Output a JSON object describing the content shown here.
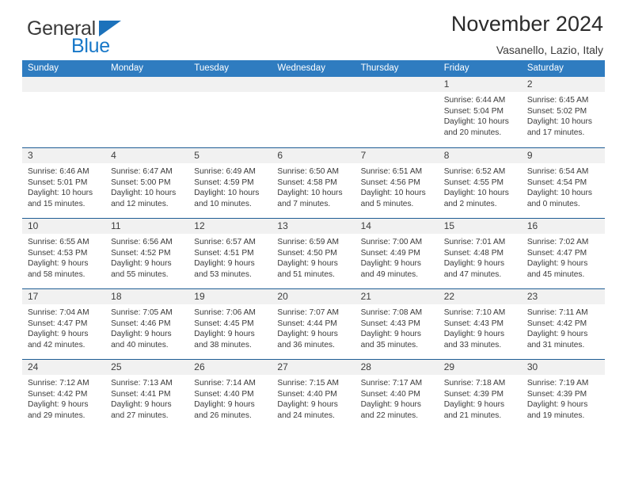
{
  "logo": {
    "word_top": "General",
    "word_bottom": "Blue",
    "triangle_icon": "triangle-icon",
    "color_dark": "#3a3a3a",
    "color_blue": "#1878c8"
  },
  "header": {
    "title": "November 2024",
    "subtitle": "Vasanello, Lazio, Italy"
  },
  "theme": {
    "header_blue": "#2f7cc0",
    "row_rule": "#1f5d94",
    "daynum_bg": "#f1f1f1",
    "text": "#3a3a3a"
  },
  "calendar": {
    "weekdays": [
      "Sunday",
      "Monday",
      "Tuesday",
      "Wednesday",
      "Thursday",
      "Friday",
      "Saturday"
    ],
    "labels": {
      "sunrise": "Sunrise:",
      "sunset": "Sunset:",
      "daylight": "Daylight:"
    },
    "weeks": [
      [
        {
          "day": ""
        },
        {
          "day": ""
        },
        {
          "day": ""
        },
        {
          "day": ""
        },
        {
          "day": ""
        },
        {
          "day": "1",
          "sunrise": "Sunrise: 6:44 AM",
          "sunset": "Sunset: 5:04 PM",
          "daylight": "Daylight: 10 hours and 20 minutes."
        },
        {
          "day": "2",
          "sunrise": "Sunrise: 6:45 AM",
          "sunset": "Sunset: 5:02 PM",
          "daylight": "Daylight: 10 hours and 17 minutes."
        }
      ],
      [
        {
          "day": "3",
          "sunrise": "Sunrise: 6:46 AM",
          "sunset": "Sunset: 5:01 PM",
          "daylight": "Daylight: 10 hours and 15 minutes."
        },
        {
          "day": "4",
          "sunrise": "Sunrise: 6:47 AM",
          "sunset": "Sunset: 5:00 PM",
          "daylight": "Daylight: 10 hours and 12 minutes."
        },
        {
          "day": "5",
          "sunrise": "Sunrise: 6:49 AM",
          "sunset": "Sunset: 4:59 PM",
          "daylight": "Daylight: 10 hours and 10 minutes."
        },
        {
          "day": "6",
          "sunrise": "Sunrise: 6:50 AM",
          "sunset": "Sunset: 4:58 PM",
          "daylight": "Daylight: 10 hours and 7 minutes."
        },
        {
          "day": "7",
          "sunrise": "Sunrise: 6:51 AM",
          "sunset": "Sunset: 4:56 PM",
          "daylight": "Daylight: 10 hours and 5 minutes."
        },
        {
          "day": "8",
          "sunrise": "Sunrise: 6:52 AM",
          "sunset": "Sunset: 4:55 PM",
          "daylight": "Daylight: 10 hours and 2 minutes."
        },
        {
          "day": "9",
          "sunrise": "Sunrise: 6:54 AM",
          "sunset": "Sunset: 4:54 PM",
          "daylight": "Daylight: 10 hours and 0 minutes."
        }
      ],
      [
        {
          "day": "10",
          "sunrise": "Sunrise: 6:55 AM",
          "sunset": "Sunset: 4:53 PM",
          "daylight": "Daylight: 9 hours and 58 minutes."
        },
        {
          "day": "11",
          "sunrise": "Sunrise: 6:56 AM",
          "sunset": "Sunset: 4:52 PM",
          "daylight": "Daylight: 9 hours and 55 minutes."
        },
        {
          "day": "12",
          "sunrise": "Sunrise: 6:57 AM",
          "sunset": "Sunset: 4:51 PM",
          "daylight": "Daylight: 9 hours and 53 minutes."
        },
        {
          "day": "13",
          "sunrise": "Sunrise: 6:59 AM",
          "sunset": "Sunset: 4:50 PM",
          "daylight": "Daylight: 9 hours and 51 minutes."
        },
        {
          "day": "14",
          "sunrise": "Sunrise: 7:00 AM",
          "sunset": "Sunset: 4:49 PM",
          "daylight": "Daylight: 9 hours and 49 minutes."
        },
        {
          "day": "15",
          "sunrise": "Sunrise: 7:01 AM",
          "sunset": "Sunset: 4:48 PM",
          "daylight": "Daylight: 9 hours and 47 minutes."
        },
        {
          "day": "16",
          "sunrise": "Sunrise: 7:02 AM",
          "sunset": "Sunset: 4:47 PM",
          "daylight": "Daylight: 9 hours and 45 minutes."
        }
      ],
      [
        {
          "day": "17",
          "sunrise": "Sunrise: 7:04 AM",
          "sunset": "Sunset: 4:47 PM",
          "daylight": "Daylight: 9 hours and 42 minutes."
        },
        {
          "day": "18",
          "sunrise": "Sunrise: 7:05 AM",
          "sunset": "Sunset: 4:46 PM",
          "daylight": "Daylight: 9 hours and 40 minutes."
        },
        {
          "day": "19",
          "sunrise": "Sunrise: 7:06 AM",
          "sunset": "Sunset: 4:45 PM",
          "daylight": "Daylight: 9 hours and 38 minutes."
        },
        {
          "day": "20",
          "sunrise": "Sunrise: 7:07 AM",
          "sunset": "Sunset: 4:44 PM",
          "daylight": "Daylight: 9 hours and 36 minutes."
        },
        {
          "day": "21",
          "sunrise": "Sunrise: 7:08 AM",
          "sunset": "Sunset: 4:43 PM",
          "daylight": "Daylight: 9 hours and 35 minutes."
        },
        {
          "day": "22",
          "sunrise": "Sunrise: 7:10 AM",
          "sunset": "Sunset: 4:43 PM",
          "daylight": "Daylight: 9 hours and 33 minutes."
        },
        {
          "day": "23",
          "sunrise": "Sunrise: 7:11 AM",
          "sunset": "Sunset: 4:42 PM",
          "daylight": "Daylight: 9 hours and 31 minutes."
        }
      ],
      [
        {
          "day": "24",
          "sunrise": "Sunrise: 7:12 AM",
          "sunset": "Sunset: 4:42 PM",
          "daylight": "Daylight: 9 hours and 29 minutes."
        },
        {
          "day": "25",
          "sunrise": "Sunrise: 7:13 AM",
          "sunset": "Sunset: 4:41 PM",
          "daylight": "Daylight: 9 hours and 27 minutes."
        },
        {
          "day": "26",
          "sunrise": "Sunrise: 7:14 AM",
          "sunset": "Sunset: 4:40 PM",
          "daylight": "Daylight: 9 hours and 26 minutes."
        },
        {
          "day": "27",
          "sunrise": "Sunrise: 7:15 AM",
          "sunset": "Sunset: 4:40 PM",
          "daylight": "Daylight: 9 hours and 24 minutes."
        },
        {
          "day": "28",
          "sunrise": "Sunrise: 7:17 AM",
          "sunset": "Sunset: 4:40 PM",
          "daylight": "Daylight: 9 hours and 22 minutes."
        },
        {
          "day": "29",
          "sunrise": "Sunrise: 7:18 AM",
          "sunset": "Sunset: 4:39 PM",
          "daylight": "Daylight: 9 hours and 21 minutes."
        },
        {
          "day": "30",
          "sunrise": "Sunrise: 7:19 AM",
          "sunset": "Sunset: 4:39 PM",
          "daylight": "Daylight: 9 hours and 19 minutes."
        }
      ]
    ]
  }
}
